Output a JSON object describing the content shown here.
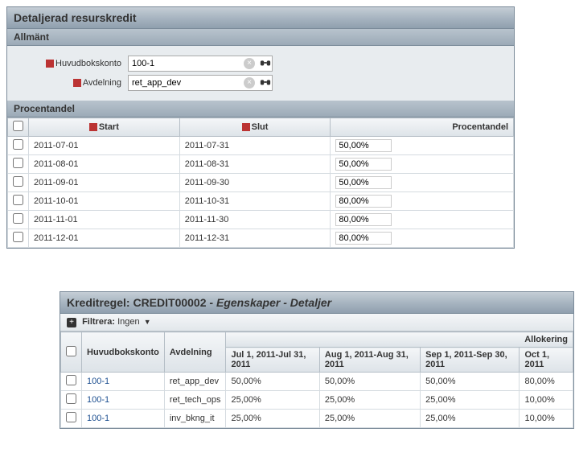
{
  "panel1": {
    "title": "Detaljerad resurskredit",
    "general_section": "Allmänt",
    "ledger_label": "Huvudbokskonto",
    "ledger_value": "100-1",
    "dept_label": "Avdelning",
    "dept_value": "ret_app_dev",
    "percent_section": "Procentandel",
    "col_start": "Start",
    "col_end": "Slut",
    "col_percent": "Procentandel",
    "rows": [
      {
        "start": "2011-07-01",
        "end": "2011-07-31",
        "pct": "50,00%"
      },
      {
        "start": "2011-08-01",
        "end": "2011-08-31",
        "pct": "50,00%"
      },
      {
        "start": "2011-09-01",
        "end": "2011-09-30",
        "pct": "50,00%"
      },
      {
        "start": "2011-10-01",
        "end": "2011-10-31",
        "pct": "80,00%"
      },
      {
        "start": "2011-11-01",
        "end": "2011-11-30",
        "pct": "80,00%"
      },
      {
        "start": "2011-12-01",
        "end": "2011-12-31",
        "pct": "80,00%"
      }
    ]
  },
  "panel2": {
    "title_prefix": "Kreditregel: CREDIT00002 - ",
    "title_italic": "Egenskaper - Detaljer",
    "filter_label": "Filtrera:",
    "filter_value": "Ingen",
    "allocation_header": "Allokering",
    "col_ledger": "Huvudbokskonto",
    "col_dept": "Avdelning",
    "periods": [
      "Jul 1, 2011-Jul 31, 2011",
      "Aug 1, 2011-Aug 31, 2011",
      "Sep 1, 2011-Sep 30, 2011",
      "Oct 1, 2011"
    ],
    "rows": [
      {
        "ledger": "100-1",
        "dept": "ret_app_dev",
        "vals": [
          "50,00%",
          "50,00%",
          "50,00%",
          "80,00%"
        ]
      },
      {
        "ledger": "100-1",
        "dept": "ret_tech_ops",
        "vals": [
          "25,00%",
          "25,00%",
          "25,00%",
          "10,00%"
        ]
      },
      {
        "ledger": "100-1",
        "dept": "inv_bkng_it",
        "vals": [
          "25,00%",
          "25,00%",
          "25,00%",
          "10,00%"
        ]
      }
    ]
  }
}
